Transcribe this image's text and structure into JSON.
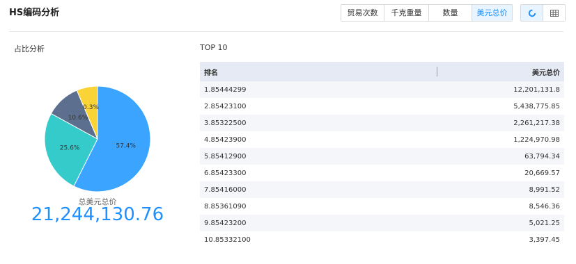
{
  "header": {
    "title": "HS编码分析",
    "metric_tabs": [
      {
        "label": "贸易次数",
        "active": false
      },
      {
        "label": "千克重量",
        "active": false
      },
      {
        "label": "数量",
        "active": false
      },
      {
        "label": "美元总价",
        "active": true
      }
    ],
    "view_toggles": [
      {
        "icon": "pie-chart-icon",
        "active": true
      },
      {
        "icon": "table-icon",
        "active": false
      }
    ]
  },
  "share_panel": {
    "label": "占比分析",
    "total_label": "总美元总价",
    "total_value": "21,244,130.76"
  },
  "chart_data": {
    "type": "pie",
    "slices": [
      {
        "label": "57.4%",
        "value": 57.4,
        "color": "#3aa4ff"
      },
      {
        "label": "25.6%",
        "value": 25.6,
        "color": "#36cbcb"
      },
      {
        "label": "10.6%",
        "value": 10.6,
        "color": "#5d6f8f"
      },
      {
        "label": "0.3%",
        "value": 6.4,
        "color": "#fad337"
      }
    ]
  },
  "top_table": {
    "label": "TOP 10",
    "columns": [
      "排名",
      "美元总价"
    ],
    "rows": [
      {
        "rank": "1.85444299",
        "value": "12,201,131.8"
      },
      {
        "rank": "2.85423100",
        "value": "5,438,775.85"
      },
      {
        "rank": "3.85322500",
        "value": "2,261,217.38"
      },
      {
        "rank": "4.85423900",
        "value": "1,224,970.98"
      },
      {
        "rank": "5.85412900",
        "value": "63,794.34"
      },
      {
        "rank": "6.85423300",
        "value": "20,669.57"
      },
      {
        "rank": "7.85416000",
        "value": "8,991.52"
      },
      {
        "rank": "8.85361090",
        "value": "8,546.36"
      },
      {
        "rank": "9.85423200",
        "value": "5,021.25"
      },
      {
        "rank": "10.85332100",
        "value": "3,397.45"
      }
    ]
  },
  "colors": {
    "accent": "#1890ff",
    "total_value": "#1e90ff",
    "active_bg": "#e8f4ff",
    "table_header_bg": "#e5eaf5",
    "row_alt_bg": "#f4f6fa"
  }
}
